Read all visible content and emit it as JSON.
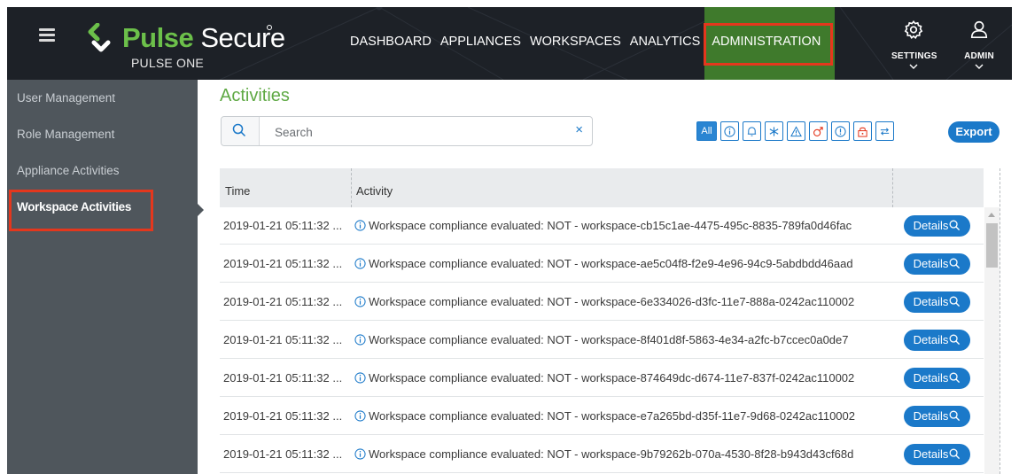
{
  "brand": {
    "name_part1": "Pulse",
    "name_part2": "Secure",
    "subtitle": "PULSE ONE",
    "green": "#6cc04a"
  },
  "nav": {
    "items": [
      {
        "label": "DASHBOARD",
        "active": false
      },
      {
        "label": "APPLIANCES",
        "active": false
      },
      {
        "label": "WORKSPACES",
        "active": false
      },
      {
        "label": "ANALYTICS",
        "active": false
      },
      {
        "label": "ADMINISTRATION",
        "active": true
      }
    ],
    "settings_label": "SETTINGS",
    "settings_icon": "gear-icon",
    "admin_label": "ADMIN",
    "admin_icon": "user-icon",
    "active_color": "#3f7a2c",
    "highlight_color": "#e4371d"
  },
  "sidebar": {
    "items": [
      {
        "label": "User Management"
      },
      {
        "label": "Role Management"
      },
      {
        "label": "Appliance Activities"
      },
      {
        "label": "Workspace Activities",
        "active": true
      }
    ]
  },
  "main": {
    "title": "Activities",
    "search": {
      "placeholder": "Search",
      "value": "",
      "clear": "×"
    },
    "filters": {
      "all_label": "All",
      "icons": [
        "info-icon",
        "bell-icon",
        "asterisk-icon",
        "warning-icon",
        "male-icon",
        "exclamation-icon",
        "lock-icon",
        "arrows-icon"
      ]
    },
    "export_label": "Export",
    "table": {
      "columns": [
        "Time",
        "Activity"
      ],
      "details_label": "Details",
      "rows": [
        {
          "time": "2019-01-21 05:11:32 ...",
          "activity": "Workspace compliance evaluated: NOT - workspace-cb15c1ae-4475-495c-8835-789fa0d46fac"
        },
        {
          "time": "2019-01-21 05:11:32 ...",
          "activity": "Workspace compliance evaluated: NOT - workspace-ae5c04f8-f2e9-4e96-94c9-5abdbdd46aad"
        },
        {
          "time": "2019-01-21 05:11:32 ...",
          "activity": "Workspace compliance evaluated: NOT - workspace-6e334026-d3fc-11e7-888a-0242ac110002"
        },
        {
          "time": "2019-01-21 05:11:32 ...",
          "activity": "Workspace compliance evaluated: NOT - workspace-8f401d8f-5863-4e34-a2fc-b7ccec0a0de7"
        },
        {
          "time": "2019-01-21 05:11:32 ...",
          "activity": "Workspace compliance evaluated: NOT - workspace-874649dc-d674-11e7-837f-0242ac110002"
        },
        {
          "time": "2019-01-21 05:11:32 ...",
          "activity": "Workspace compliance evaluated: NOT - workspace-e7a265bd-d35f-11e7-9d68-0242ac110002"
        },
        {
          "time": "2019-01-21 05:11:32 ...",
          "activity": "Workspace compliance evaluated: NOT - workspace-9b79262b-070a-4530-8f28-b943d43cf68d"
        }
      ]
    }
  }
}
